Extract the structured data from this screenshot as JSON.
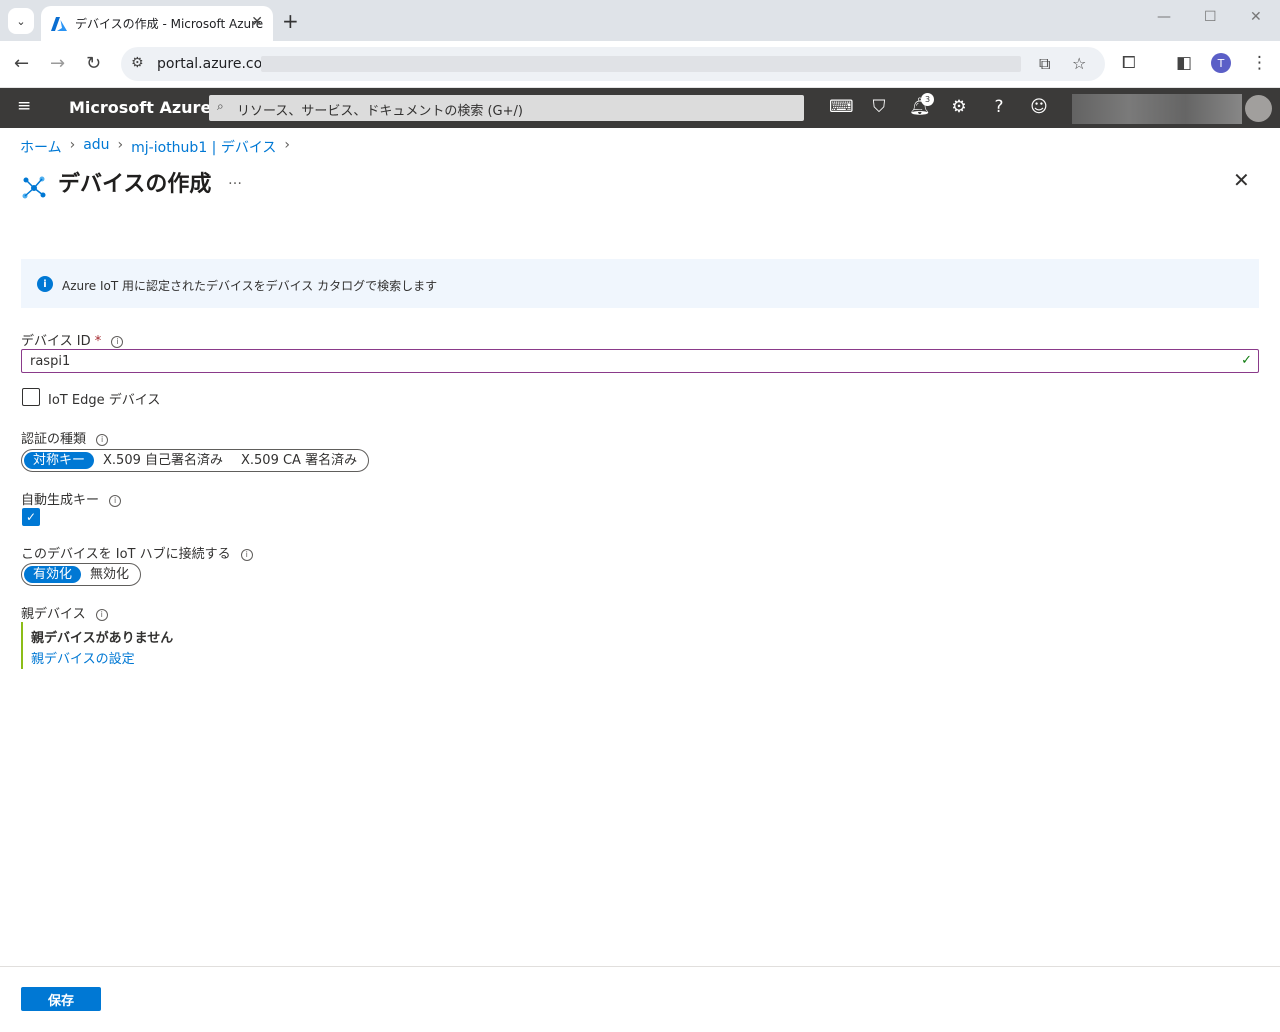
{
  "browser": {
    "tab_title": "デバイスの作成 - Microsoft Azure",
    "url": "portal.azure.com",
    "profile_initial": "T"
  },
  "azure_header": {
    "brand": "Microsoft Azure",
    "search_placeholder": "リソース、サービス、ドキュメントの検索 (G+/)",
    "notification_count": "3"
  },
  "breadcrumb": [
    "ホーム",
    "adu",
    "mj-iothub1 | デバイス"
  ],
  "page": {
    "title": "デバイスの作成",
    "more": "…"
  },
  "info_banner": "Azure IoT 用に認定されたデバイスをデバイス カタログで検索します",
  "form": {
    "device_id_label": "デバイス ID",
    "required_mark": "*",
    "device_id_value": "raspi1",
    "iot_edge_label": "IoT Edge デバイス",
    "iot_edge_checked": false,
    "auth_label": "認証の種類",
    "auth_options": [
      "対称キー",
      "X.509 自己署名済み",
      "X.509 CA 署名済み"
    ],
    "auth_selected": "対称キー",
    "autogen_label": "自動生成キー",
    "autogen_checked": true,
    "connect_label": "このデバイスを IoT ハブに接続する",
    "connect_options": [
      "有効化",
      "無効化"
    ],
    "connect_selected": "有効化",
    "parent_label": "親デバイス",
    "parent_none": "親デバイスがありません",
    "parent_link": "親デバイスの設定"
  },
  "footer": {
    "save_label": "保存"
  },
  "colors": {
    "accent": "#0078d4",
    "header_bg": "#3b3a39",
    "parent_border": "#8cbd18"
  }
}
